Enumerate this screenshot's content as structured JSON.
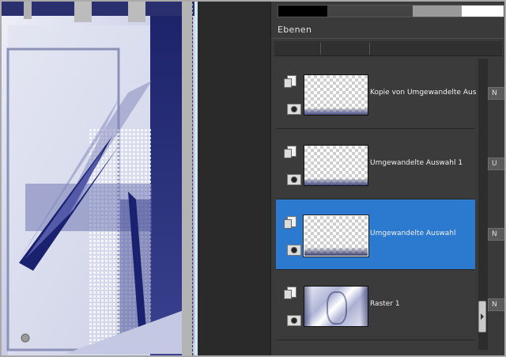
{
  "panel": {
    "title": "Ebenen"
  },
  "layers": [
    {
      "name": "Kopie von Umgewandelte Auswahl",
      "selected": false,
      "thumb": "transparent-strip",
      "button_label": "N"
    },
    {
      "name": "Umgewandelte Auswahl 1",
      "selected": false,
      "thumb": "transparent-strip",
      "button_label": "U"
    },
    {
      "name": "Umgewandelte Auswahl",
      "selected": true,
      "thumb": "transparent-strip",
      "button_label": "N"
    },
    {
      "name": "Raster 1",
      "selected": false,
      "thumb": "raster",
      "button_label": "N"
    }
  ],
  "icons": {
    "visibility": "eye-icon",
    "layer_type": "page-icon",
    "scroll_handle": "scroll-grip-icon"
  },
  "colors": {
    "selection": "#2b7ad0",
    "panel_bg": "#3a3a3a",
    "canvas_accent": "#1f2670"
  }
}
